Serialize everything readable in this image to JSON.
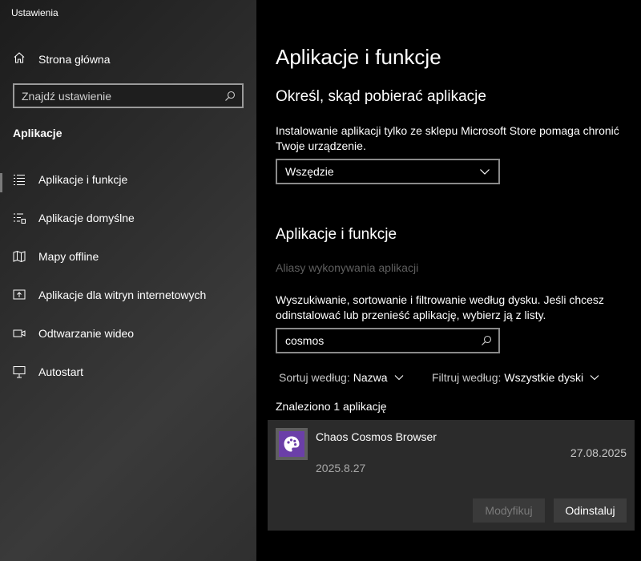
{
  "window": {
    "title": "Ustawienia"
  },
  "sidebar": {
    "home_label": "Strona główna",
    "search_placeholder": "Znajdź ustawienie",
    "section_title": "Aplikacje",
    "items": [
      {
        "label": "Aplikacje i funkcje",
        "icon": "apps-list-icon",
        "selected": true
      },
      {
        "label": "Aplikacje domyślne",
        "icon": "default-apps-icon",
        "selected": false
      },
      {
        "label": "Mapy offline",
        "icon": "map-icon",
        "selected": false
      },
      {
        "label": "Aplikacje dla witryn internetowych",
        "icon": "web-apps-icon",
        "selected": false
      },
      {
        "label": "Odtwarzanie wideo",
        "icon": "video-icon",
        "selected": false
      },
      {
        "label": "Autostart",
        "icon": "startup-icon",
        "selected": false
      }
    ]
  },
  "main": {
    "title": "Aplikacje i funkcje",
    "source_heading": "Określ, skąd pobierać aplikacje",
    "source_description": "Instalowanie aplikacji tylko ze sklepu Microsoft Store pomaga chronić Twoje urządzenie.",
    "source_dropdown_value": "Wszędzie",
    "apps_heading": "Aplikacje i funkcje",
    "aliases_link": "Aliasy wykonywania aplikacji",
    "apps_description": "Wyszukiwanie, sortowanie i filtrowanie według dysku. Jeśli chcesz odinstalować lub przenieść aplikację, wybierz ją z listy.",
    "app_search_value": "cosmos",
    "sort_label": "Sortuj według:",
    "sort_value": "Nazwa",
    "filter_label": "Filtruj według:",
    "filter_value": "Wszystkie dyski",
    "found_text": "Znaleziono 1 aplikację",
    "app": {
      "name": "Chaos Cosmos Browser",
      "date": "27.08.2025",
      "version": "2025.8.27",
      "icon": "palette-icon",
      "modify_label": "Modyfikuj",
      "uninstall_label": "Odinstaluj"
    }
  },
  "colors": {
    "accent_app_icon": "#6b3fa8",
    "card_background": "#2b2b2b",
    "disabled_text": "#5f5f5f"
  }
}
